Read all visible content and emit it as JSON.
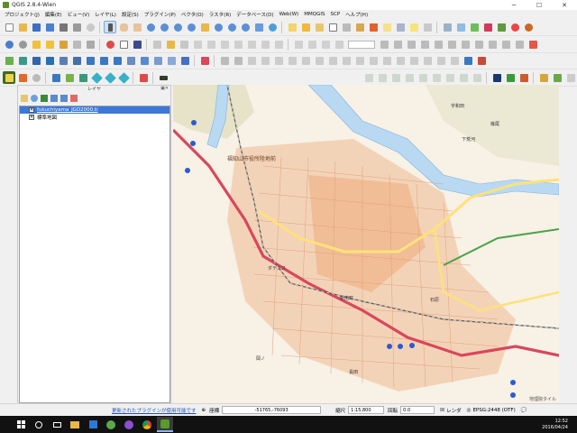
{
  "window": {
    "title": "QGIS 2.8.4-Wien",
    "controls": {
      "minimize": "─",
      "maximize": "☐",
      "close": "✕"
    }
  },
  "menu": [
    "プロジェクト(J)",
    "編集(E)",
    "ビュー(V)",
    "レイヤ(L)",
    "設定(S)",
    "プラグイン(P)",
    "ベクタ(O)",
    "ラスタ(R)",
    "データベース(D)",
    "Web(W)",
    "MMQGIS",
    "SCP",
    "ヘルプ(H)"
  ],
  "layer_panel": {
    "title": "レイヤ",
    "layers": [
      {
        "name": "fukuchiyama_JGD2000.ti",
        "checked": true,
        "selected": true
      },
      {
        "name": "標準地図",
        "checked": true,
        "selected": false
      }
    ]
  },
  "map": {
    "labels": {
      "city_hall": "福知山市役所陸地前",
      "area1": "字和田",
      "area2": "下荒河",
      "area3": "篠尾",
      "area4": "駅南町",
      "area5": "岡ノ",
      "area6": "石原",
      "area7": "長田",
      "street": "ダテニス",
      "attribution": "地理院タイル"
    }
  },
  "statusbar": {
    "plugin_link": "更新されたプラグインが使用可能です",
    "coord_label": "座標",
    "coord_value": "-51765,-76093",
    "scale_label": "縮尺",
    "scale_value": "1:15,800",
    "rotation_label": "回転",
    "rotation_value": "0.0",
    "render_label": "レンダ",
    "crs": "EPSG:2448 (OTF)"
  },
  "taskbar": {
    "time": "12:52",
    "date": "2016/04/24"
  },
  "colors": {
    "selected": "#3b78d8",
    "road_red": "#d9475c",
    "road_yellow": "#ffe17a",
    "river": "#b9d9f2",
    "urban": "#f2c8a8"
  }
}
